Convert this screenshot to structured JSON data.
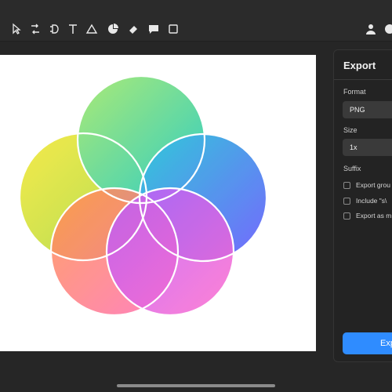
{
  "panel": {
    "title": "Export",
    "format_label": "Format",
    "format_value": "PNG",
    "size_label": "Size",
    "size_value": "1x",
    "suffix_label": "Suffix",
    "options": [
      {
        "label": "Export grou",
        "checked": false
      },
      {
        "label": "Include \"s\\",
        "checked": false
      },
      {
        "label": "Export as m",
        "checked": false
      }
    ],
    "export_button": "Exp"
  },
  "toolbar": {
    "icons": [
      "select-arrow-icon",
      "path-tool-icon",
      "frame-tool-icon",
      "text-tool-icon",
      "triangle-tool-icon",
      "pie-chart-icon",
      "eraser-icon",
      "comment-icon",
      "rectangle-icon",
      "user-icon",
      "share-icon"
    ]
  },
  "colors": {
    "accent": "#2f8cff",
    "artboard": "#ffffff",
    "panel_bg": "#232323"
  }
}
